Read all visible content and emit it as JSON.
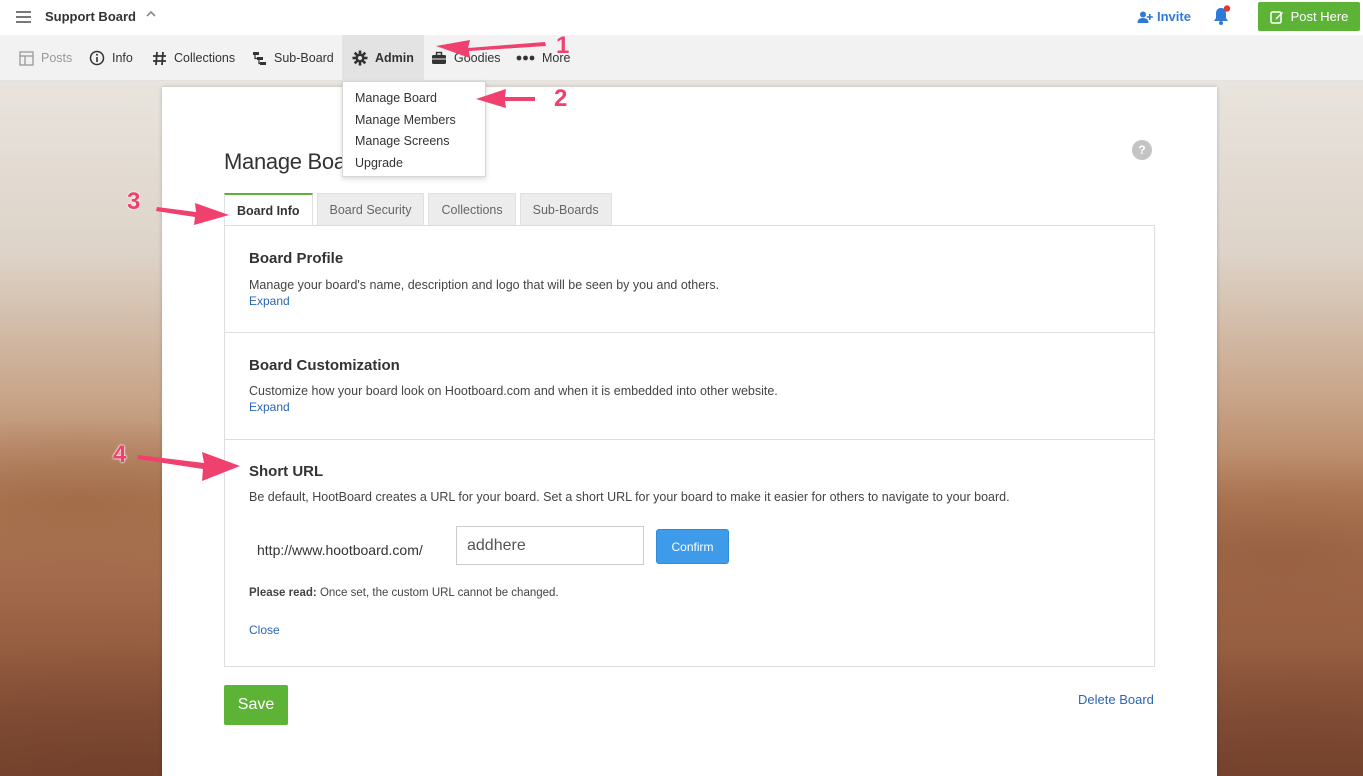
{
  "topbar": {
    "board_title": "Support Board",
    "invite_label": "Invite",
    "post_here_label": "Post Here",
    "accent_color": "#5cb335",
    "notification_badge_color": "#e53935"
  },
  "nav": {
    "items": [
      {
        "label": "Posts",
        "icon": "layout-icon"
      },
      {
        "label": "Info",
        "icon": "info-icon"
      },
      {
        "label": "Collections",
        "icon": "hash-icon"
      },
      {
        "label": "Sub-Board",
        "icon": "tree-icon"
      },
      {
        "label": "Admin",
        "icon": "gear-icon"
      },
      {
        "label": "Goodies",
        "icon": "briefcase-icon"
      },
      {
        "label": "More",
        "icon": "dots-icon"
      }
    ]
  },
  "admin_menu": {
    "items": [
      "Manage Board",
      "Manage Members",
      "Manage Screens",
      "Upgrade"
    ]
  },
  "page": {
    "title": "Manage Boa",
    "help": "?"
  },
  "tabs": [
    "Board Info",
    "Board Security",
    "Collections",
    "Sub-Boards"
  ],
  "sections": {
    "profile": {
      "title": "Board Profile",
      "description": "Manage your board's name, description and logo that will be seen by you and others.",
      "link": "Expand"
    },
    "customization": {
      "title": "Board Customization",
      "description": "Customize how your board look on Hootboard.com and when it is embedded into other website.",
      "link": "Expand"
    },
    "short_url": {
      "title": "Short URL",
      "description": "Be default, HootBoard creates a URL for your board. Set a short URL for your board to make it easier for others to navigate to your board.",
      "prefix": "http://www.hootboard.com/",
      "input_value": "addhere",
      "confirm_label": "Confirm",
      "note_bold": "Please read:",
      "note_text": " Once set, the custom URL cannot be changed.",
      "close_label": "Close"
    }
  },
  "footer": {
    "save_label": "Save",
    "delete_label": "Delete Board"
  },
  "annotations": [
    "1",
    "2",
    "3",
    "4"
  ],
  "annotation_color": "#f0406e"
}
